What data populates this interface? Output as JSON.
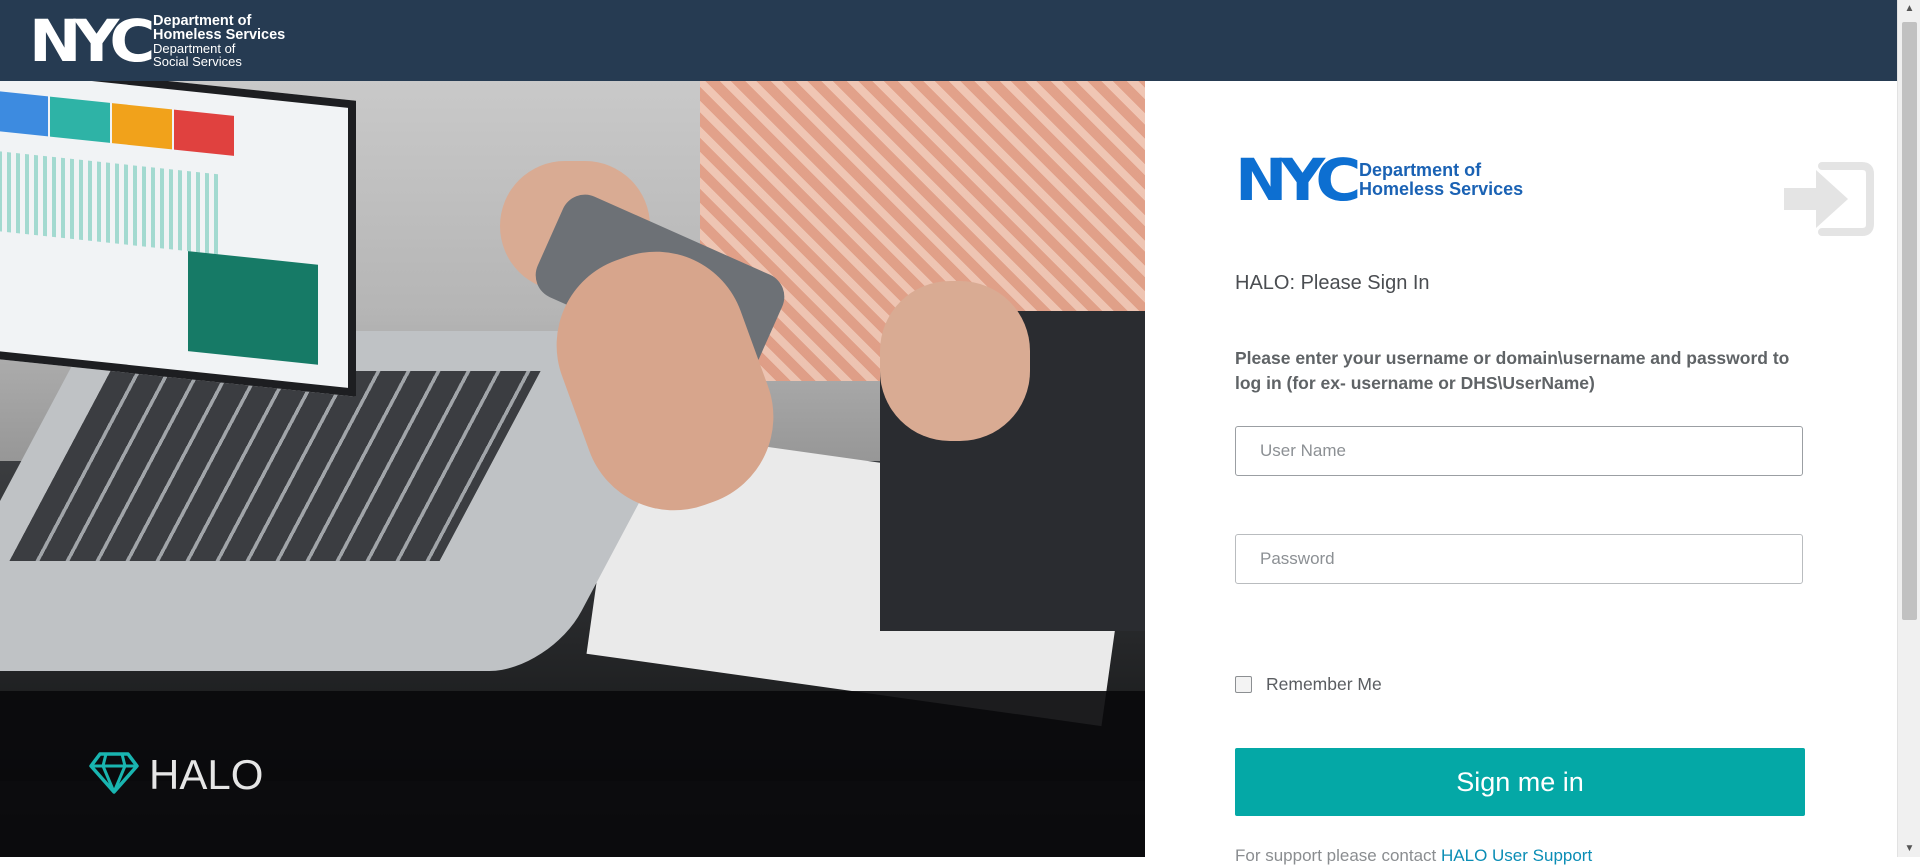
{
  "header": {
    "logo_text": "NYC",
    "dept_line1": "Department of",
    "dept_line2": "Homeless Services",
    "dept_line3": "Department of",
    "dept_line4": "Social Services"
  },
  "hero": {
    "brand": "HALO",
    "brand_icon": "diamond-icon"
  },
  "login": {
    "logo_text": "NYC",
    "dept_line1": "Department of",
    "dept_line2": "Homeless Services",
    "heading": "HALO: Please Sign In",
    "instructions": "Please enter your username or domain\\username and password to log in (for ex- username or DHS\\UserName)",
    "username_placeholder": "User Name",
    "password_placeholder": "Password",
    "remember_label": "Remember Me",
    "submit_label": "Sign me in",
    "support_text": "For support please contact",
    "support_link": "HALO User Support"
  },
  "colors": {
    "header_bg": "#263b52",
    "accent_teal": "#04a8a6",
    "nyc_blue": "#0d6fd1",
    "link": "#0a8db5"
  }
}
